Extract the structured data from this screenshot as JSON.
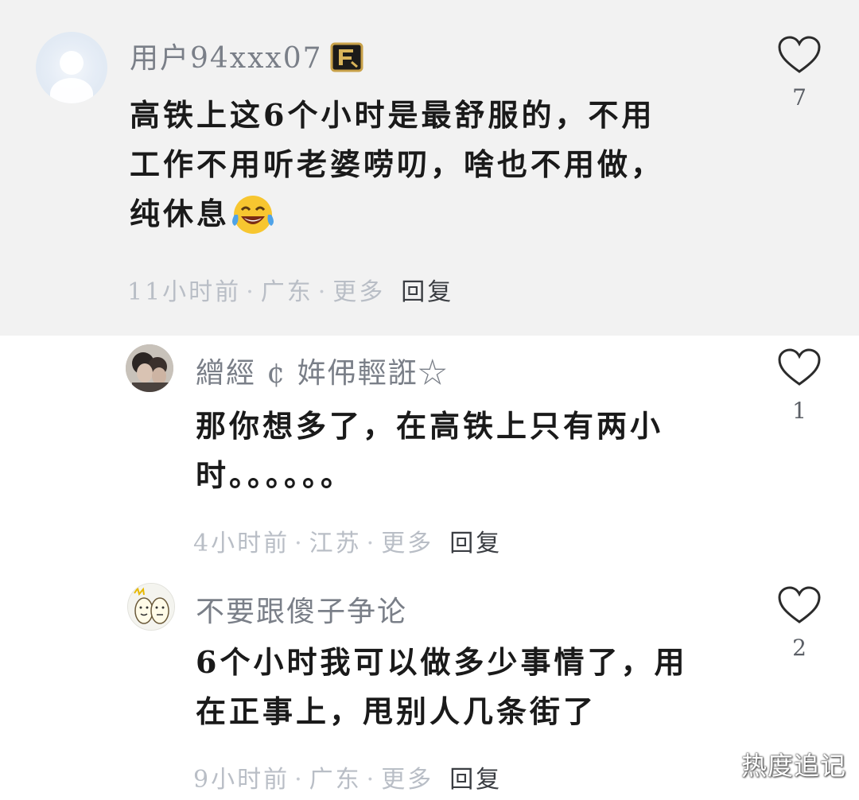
{
  "main_comment": {
    "username": "用户94xxx07",
    "badge_icon": "scroll-badge-icon",
    "text_lines": [
      "高铁上这6个小时是最舒服的，不用",
      "工作不用听老婆唠叨，啥也不用做，",
      "纯休息"
    ],
    "emoji": "tears-of-joy-emoji",
    "time": "11小时前",
    "location": "广东",
    "more": "更多",
    "reply": "回复",
    "likes": "7",
    "background": "#f2f2f2"
  },
  "replies": [
    {
      "username": "繒經 ¢ 姩伄輕誑☆",
      "text_lines": [
        "那你想多了，在高铁上只有两小",
        "时。。。。。。"
      ],
      "time": "4小时前",
      "location": "江苏",
      "more": "更多",
      "reply": "回复",
      "likes": "1"
    },
    {
      "username": "不要跟傻子争论",
      "text_lines": [
        "6个小时我可以做多少事情了，用",
        "在正事上，甩别人几条街了"
      ],
      "time": "9小时前",
      "location": "广东",
      "more": "更多",
      "reply": "回复",
      "likes": "2"
    }
  ],
  "watermark": "热度追记",
  "colors": {
    "username": "#7a7f88",
    "body_text": "#1a1a1a",
    "meta": "#b9bec6",
    "reply": "#3a3d42"
  }
}
